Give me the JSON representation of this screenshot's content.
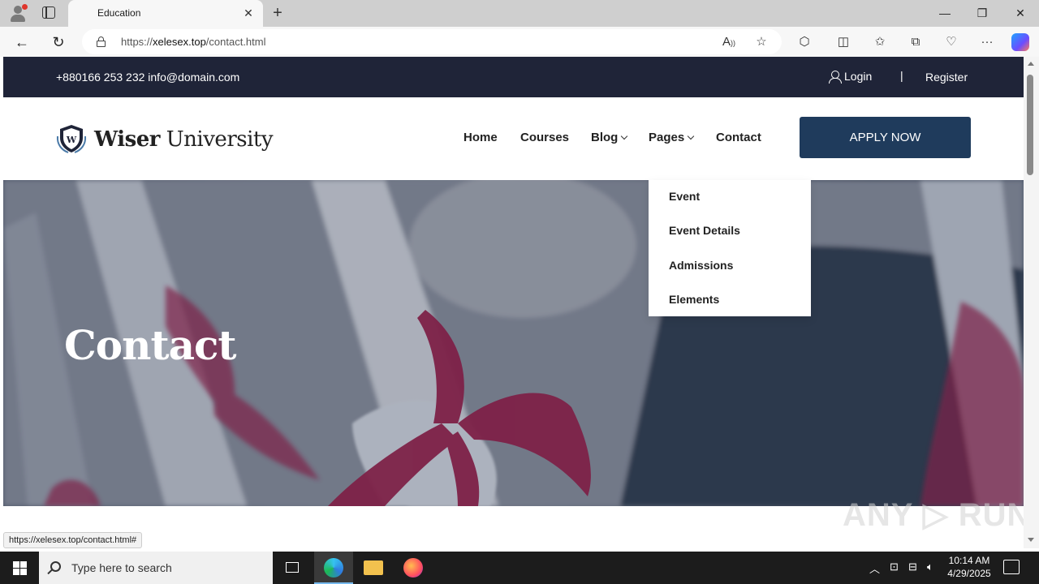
{
  "browser": {
    "tab_title": "Education",
    "tab_close": "✕",
    "new_tab": "+",
    "url_prefix": "https://",
    "url_host": "xelesex.top",
    "url_path": "/contact.html",
    "status_url": "https://xelesex.top/contact.html#"
  },
  "topbar": {
    "contact": "+880166 253 232 info@domain.com",
    "login": "Login",
    "divider": "|",
    "register": "Register"
  },
  "logo": {
    "strong": "Wiser",
    "light": " University",
    "emblem_letter": "W"
  },
  "nav": {
    "home": "Home",
    "courses": "Courses",
    "blog": "Blog",
    "pages": "Pages",
    "contact": "Contact",
    "apply": "APPLY NOW"
  },
  "dropdown": {
    "items": [
      "Event",
      "Event Details",
      "Admissions",
      "Elements"
    ]
  },
  "hero": {
    "title": "Contact"
  },
  "watermark": "ANY ▷ RUN",
  "taskbar": {
    "search_placeholder": "Type here to search",
    "time": "10:14 AM",
    "date": "4/29/2025"
  },
  "colors": {
    "topbar_bg": "#1f2438",
    "apply_bg": "#1f3b5c",
    "ribbon": "#9b1c46"
  }
}
